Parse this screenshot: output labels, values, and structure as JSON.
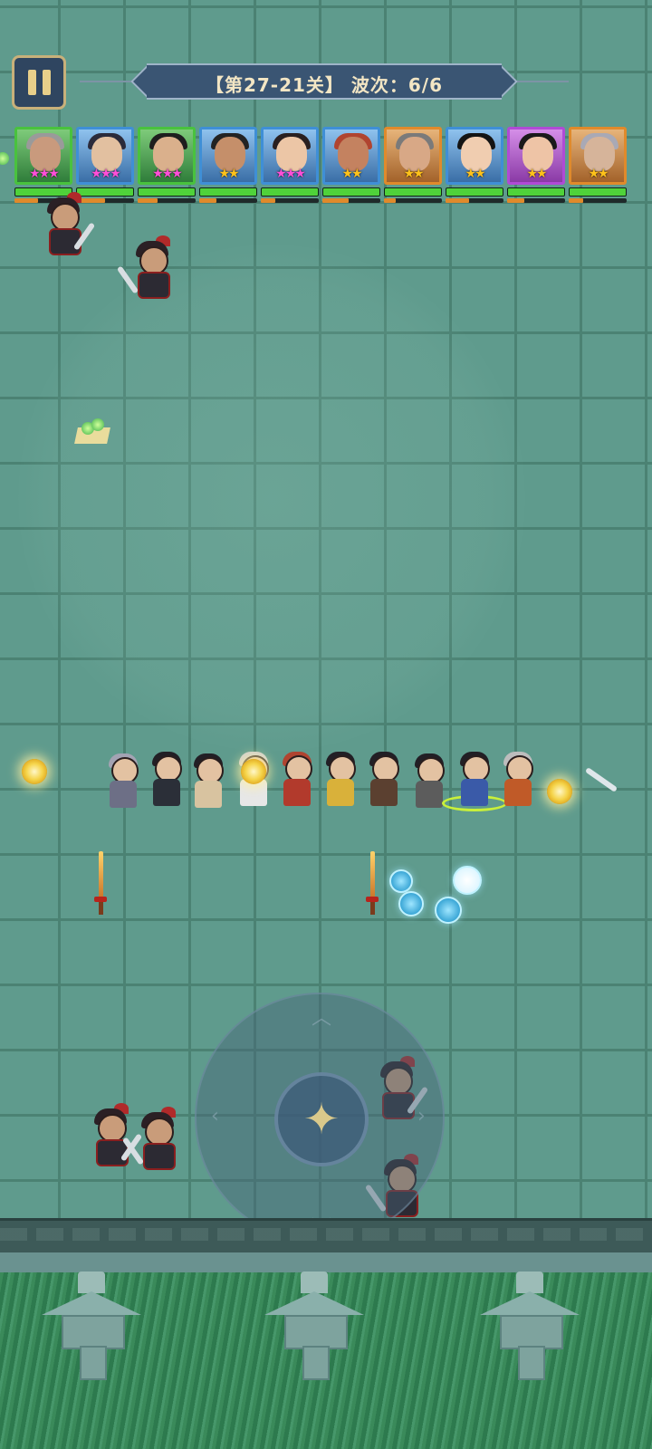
{
  "level_banner": {
    "text": "【第27-21关】 波次：6/6"
  },
  "pause_icon": "pause-icon",
  "joystick_icon": "four-point-star-icon",
  "colors": {
    "frame_green": "#49c23e",
    "frame_blue": "#3f8fd6",
    "frame_orange": "#e08a2b",
    "frame_purple": "#b04ad6",
    "star_pink": "#ff4fd8",
    "star_gold": "#ffc21a",
    "hp_green": "#4fd23a",
    "mp_orange": "#e08a2b"
  },
  "roster": [
    {
      "name": "hero-1",
      "frame": "#49c23e",
      "stars": "★★★",
      "star_color": "#ff4fd8",
      "hair": "#9a9a9a",
      "face": "#c99a7d",
      "hp": 100,
      "mp": 40
    },
    {
      "name": "hero-2",
      "frame": "#3f8fd6",
      "stars": "★★★",
      "star_color": "#ff4fd8",
      "hair": "#2b2b3b",
      "face": "#e2c0a0",
      "hp": 100,
      "mp": 50
    },
    {
      "name": "hero-3",
      "frame": "#49c23e",
      "stars": "★★★",
      "star_color": "#ff4fd8",
      "hair": "#1e1e1e",
      "face": "#dab08c",
      "hp": 100,
      "mp": 35
    },
    {
      "name": "hero-4",
      "frame": "#3f8fd6",
      "stars": "★★",
      "star_color": "#ffc21a",
      "hair": "#232323",
      "face": "#c58f6a",
      "hp": 100,
      "mp": 30
    },
    {
      "name": "hero-5",
      "frame": "#3f8fd6",
      "stars": "★★★",
      "star_color": "#ff4fd8",
      "hair": "#2a2020",
      "face": "#ecc6a6",
      "hp": 100,
      "mp": 25
    },
    {
      "name": "hero-6",
      "frame": "#3f8fd6",
      "stars": "★★",
      "star_color": "#ffc21a",
      "hair": "#b04430",
      "face": "#c48260",
      "hp": 100,
      "mp": 45
    },
    {
      "name": "hero-7",
      "frame": "#e08a2b",
      "stars": "★★",
      "star_color": "#ffc21a",
      "hair": "#7a7a7a",
      "face": "#d8a886",
      "hp": 100,
      "mp": 20
    },
    {
      "name": "hero-8",
      "frame": "#3f8fd6",
      "stars": "★★",
      "star_color": "#ffc21a",
      "hair": "#141414",
      "face": "#f0cdb0",
      "hp": 100,
      "mp": 40
    },
    {
      "name": "hero-9",
      "frame": "#b04ad6",
      "stars": "★★",
      "star_color": "#ffc21a",
      "hair": "#1a1a1a",
      "face": "#eec4a6",
      "hp": 100,
      "mp": 30
    },
    {
      "name": "hero-10",
      "frame": "#e08a2b",
      "stars": "★★",
      "star_color": "#ffc21a",
      "hair": "#a9a9b5",
      "face": "#d6b49a",
      "hp": 100,
      "mp": 25
    }
  ]
}
